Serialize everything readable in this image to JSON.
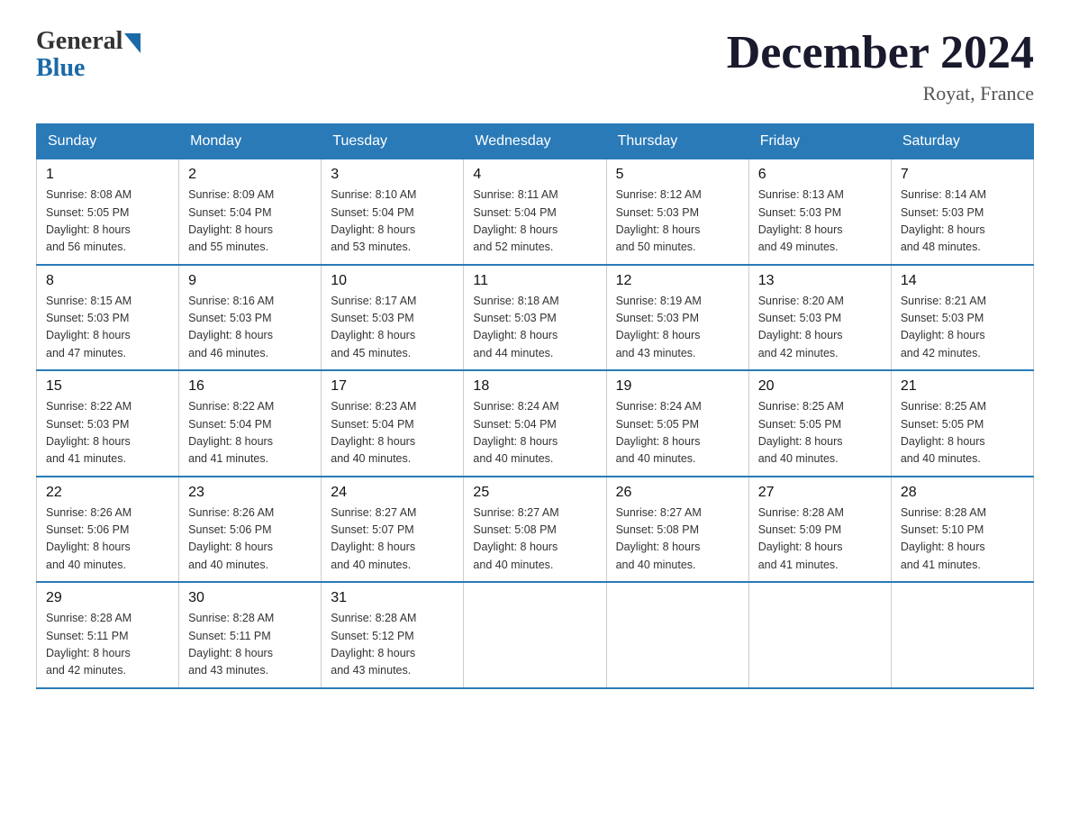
{
  "logo": {
    "general": "General",
    "blue": "Blue"
  },
  "title": "December 2024",
  "location": "Royat, France",
  "days_of_week": [
    "Sunday",
    "Monday",
    "Tuesday",
    "Wednesday",
    "Thursday",
    "Friday",
    "Saturday"
  ],
  "weeks": [
    [
      {
        "day": "1",
        "sunrise": "8:08 AM",
        "sunset": "5:05 PM",
        "daylight": "8 hours and 56 minutes."
      },
      {
        "day": "2",
        "sunrise": "8:09 AM",
        "sunset": "5:04 PM",
        "daylight": "8 hours and 55 minutes."
      },
      {
        "day": "3",
        "sunrise": "8:10 AM",
        "sunset": "5:04 PM",
        "daylight": "8 hours and 53 minutes."
      },
      {
        "day": "4",
        "sunrise": "8:11 AM",
        "sunset": "5:04 PM",
        "daylight": "8 hours and 52 minutes."
      },
      {
        "day": "5",
        "sunrise": "8:12 AM",
        "sunset": "5:03 PM",
        "daylight": "8 hours and 50 minutes."
      },
      {
        "day": "6",
        "sunrise": "8:13 AM",
        "sunset": "5:03 PM",
        "daylight": "8 hours and 49 minutes."
      },
      {
        "day": "7",
        "sunrise": "8:14 AM",
        "sunset": "5:03 PM",
        "daylight": "8 hours and 48 minutes."
      }
    ],
    [
      {
        "day": "8",
        "sunrise": "8:15 AM",
        "sunset": "5:03 PM",
        "daylight": "8 hours and 47 minutes."
      },
      {
        "day": "9",
        "sunrise": "8:16 AM",
        "sunset": "5:03 PM",
        "daylight": "8 hours and 46 minutes."
      },
      {
        "day": "10",
        "sunrise": "8:17 AM",
        "sunset": "5:03 PM",
        "daylight": "8 hours and 45 minutes."
      },
      {
        "day": "11",
        "sunrise": "8:18 AM",
        "sunset": "5:03 PM",
        "daylight": "8 hours and 44 minutes."
      },
      {
        "day": "12",
        "sunrise": "8:19 AM",
        "sunset": "5:03 PM",
        "daylight": "8 hours and 43 minutes."
      },
      {
        "day": "13",
        "sunrise": "8:20 AM",
        "sunset": "5:03 PM",
        "daylight": "8 hours and 42 minutes."
      },
      {
        "day": "14",
        "sunrise": "8:21 AM",
        "sunset": "5:03 PM",
        "daylight": "8 hours and 42 minutes."
      }
    ],
    [
      {
        "day": "15",
        "sunrise": "8:22 AM",
        "sunset": "5:03 PM",
        "daylight": "8 hours and 41 minutes."
      },
      {
        "day": "16",
        "sunrise": "8:22 AM",
        "sunset": "5:04 PM",
        "daylight": "8 hours and 41 minutes."
      },
      {
        "day": "17",
        "sunrise": "8:23 AM",
        "sunset": "5:04 PM",
        "daylight": "8 hours and 40 minutes."
      },
      {
        "day": "18",
        "sunrise": "8:24 AM",
        "sunset": "5:04 PM",
        "daylight": "8 hours and 40 minutes."
      },
      {
        "day": "19",
        "sunrise": "8:24 AM",
        "sunset": "5:05 PM",
        "daylight": "8 hours and 40 minutes."
      },
      {
        "day": "20",
        "sunrise": "8:25 AM",
        "sunset": "5:05 PM",
        "daylight": "8 hours and 40 minutes."
      },
      {
        "day": "21",
        "sunrise": "8:25 AM",
        "sunset": "5:05 PM",
        "daylight": "8 hours and 40 minutes."
      }
    ],
    [
      {
        "day": "22",
        "sunrise": "8:26 AM",
        "sunset": "5:06 PM",
        "daylight": "8 hours and 40 minutes."
      },
      {
        "day": "23",
        "sunrise": "8:26 AM",
        "sunset": "5:06 PM",
        "daylight": "8 hours and 40 minutes."
      },
      {
        "day": "24",
        "sunrise": "8:27 AM",
        "sunset": "5:07 PM",
        "daylight": "8 hours and 40 minutes."
      },
      {
        "day": "25",
        "sunrise": "8:27 AM",
        "sunset": "5:08 PM",
        "daylight": "8 hours and 40 minutes."
      },
      {
        "day": "26",
        "sunrise": "8:27 AM",
        "sunset": "5:08 PM",
        "daylight": "8 hours and 40 minutes."
      },
      {
        "day": "27",
        "sunrise": "8:28 AM",
        "sunset": "5:09 PM",
        "daylight": "8 hours and 41 minutes."
      },
      {
        "day": "28",
        "sunrise": "8:28 AM",
        "sunset": "5:10 PM",
        "daylight": "8 hours and 41 minutes."
      }
    ],
    [
      {
        "day": "29",
        "sunrise": "8:28 AM",
        "sunset": "5:11 PM",
        "daylight": "8 hours and 42 minutes."
      },
      {
        "day": "30",
        "sunrise": "8:28 AM",
        "sunset": "5:11 PM",
        "daylight": "8 hours and 43 minutes."
      },
      {
        "day": "31",
        "sunrise": "8:28 AM",
        "sunset": "5:12 PM",
        "daylight": "8 hours and 43 minutes."
      },
      null,
      null,
      null,
      null
    ]
  ]
}
